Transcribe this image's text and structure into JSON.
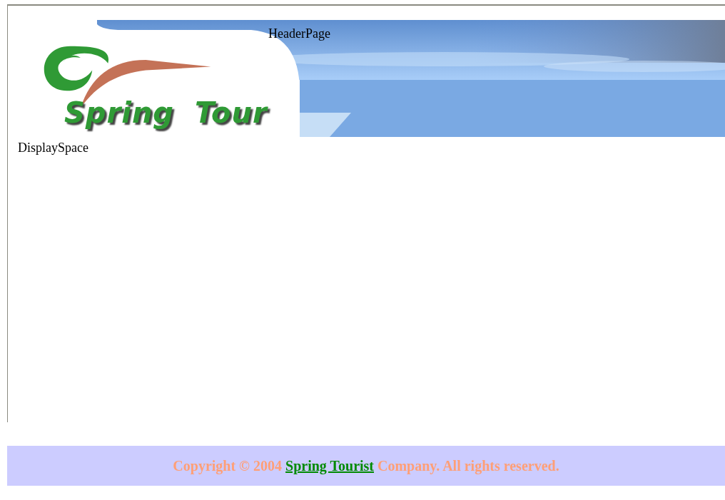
{
  "header": {
    "label": "HeaderPage",
    "logo_text": "Spring Tour"
  },
  "content": {
    "label": "DisplaySpace"
  },
  "footer": {
    "text_before": "Copyright © 2004",
    "link": "Spring Tourist",
    "text_after": "Company. All rights reserved."
  }
}
